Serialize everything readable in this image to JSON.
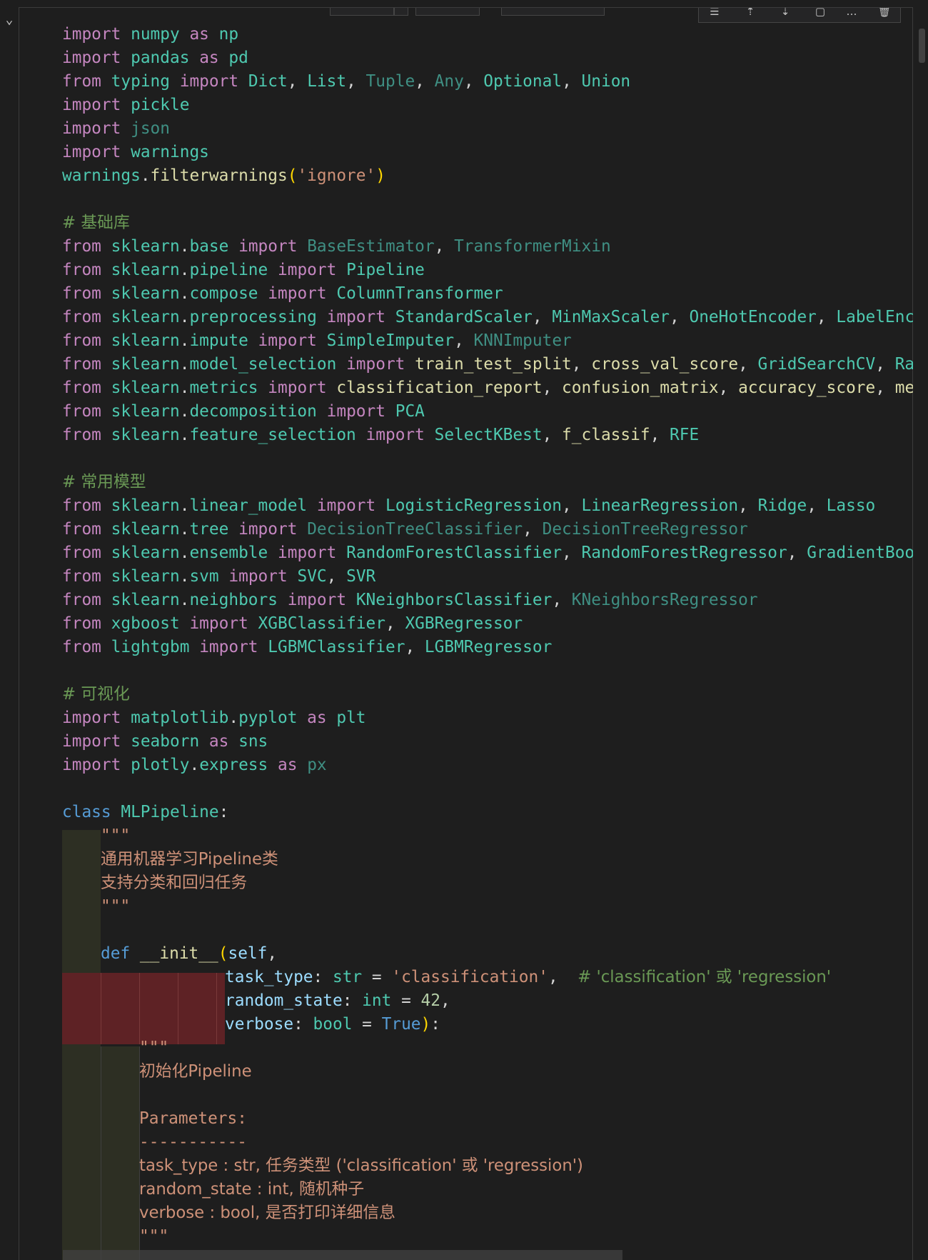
{
  "cell": {
    "collapse_icon": "chevron-down-icon",
    "toolbar_icons": [
      "format-lines-icon",
      "run-above-icon",
      "run-below-icon",
      "split-cell-icon",
      "more-icon",
      "delete-icon"
    ],
    "toolbar_glyphs": [
      "☰",
      "⇡",
      "⇣",
      "▢",
      "…",
      "🗑"
    ]
  },
  "code": {
    "l1": {
      "a": "import",
      "b": "numpy",
      "c": "as",
      "d": "np"
    },
    "l2": {
      "a": "import",
      "b": "pandas",
      "c": "as",
      "d": "pd"
    },
    "l3": {
      "a": "from",
      "b": "typing",
      "c": "import",
      "d": "Dict",
      "e": "List",
      "f": "Tuple",
      "g": "Any",
      "h": "Optional",
      "i": "Union"
    },
    "l4": {
      "a": "import",
      "b": "pickle"
    },
    "l5": {
      "a": "import",
      "b": "json"
    },
    "l6": {
      "a": "import",
      "b": "warnings"
    },
    "l7": {
      "a": "warnings",
      "b": "filterwarnings",
      "c": "'ignore'"
    },
    "c1": "# 基础库",
    "l9": {
      "a": "from",
      "b": "sklearn",
      "c": "base",
      "d": "import",
      "e": "BaseEstimator",
      "f": "TransformerMixin"
    },
    "l10": {
      "a": "from",
      "b": "sklearn",
      "c": "pipeline",
      "d": "import",
      "e": "Pipeline"
    },
    "l11": {
      "a": "from",
      "b": "sklearn",
      "c": "compose",
      "d": "import",
      "e": "ColumnTransformer"
    },
    "l12": {
      "a": "from",
      "b": "sklearn",
      "c": "preprocessing",
      "d": "import",
      "e": "StandardScaler",
      "f": "MinMaxScaler",
      "g": "OneHotEncoder",
      "h": "LabelEncod"
    },
    "l13": {
      "a": "from",
      "b": "sklearn",
      "c": "impute",
      "d": "import",
      "e": "SimpleImputer",
      "f": "KNNImputer"
    },
    "l14": {
      "a": "from",
      "b": "sklearn",
      "c": "model_selection",
      "d": "import",
      "e": "train_test_split",
      "f": "cross_val_score",
      "g": "GridSearchCV",
      "h": "Rand"
    },
    "l15": {
      "a": "from",
      "b": "sklearn",
      "c": "metrics",
      "d": "import",
      "e": "classification_report",
      "f": "confusion_matrix",
      "g": "accuracy_score",
      "h": "mean"
    },
    "l16": {
      "a": "from",
      "b": "sklearn",
      "c": "decomposition",
      "d": "import",
      "e": "PCA"
    },
    "l17": {
      "a": "from",
      "b": "sklearn",
      "c": "feature_selection",
      "d": "import",
      "e": "SelectKBest",
      "f": "f_classif",
      "g": "RFE"
    },
    "c2": "# 常用模型",
    "l19": {
      "a": "from",
      "b": "sklearn",
      "c": "linear_model",
      "d": "import",
      "e": "LogisticRegression",
      "f": "LinearRegression",
      "g": "Ridge",
      "h": "Lasso"
    },
    "l20": {
      "a": "from",
      "b": "sklearn",
      "c": "tree",
      "d": "import",
      "e": "DecisionTreeClassifier",
      "f": "DecisionTreeRegressor"
    },
    "l21": {
      "a": "from",
      "b": "sklearn",
      "c": "ensemble",
      "d": "import",
      "e": "RandomForestClassifier",
      "f": "RandomForestRegressor",
      "g": "GradientBoost"
    },
    "l22": {
      "a": "from",
      "b": "sklearn",
      "c": "svm",
      "d": "import",
      "e": "SVC",
      "f": "SVR"
    },
    "l23": {
      "a": "from",
      "b": "sklearn",
      "c": "neighbors",
      "d": "import",
      "e": "KNeighborsClassifier",
      "f": "KNeighborsRegressor"
    },
    "l24": {
      "a": "from",
      "b": "xgboost",
      "c": "import",
      "d": "XGBClassifier",
      "e": "XGBRegressor"
    },
    "l25": {
      "a": "from",
      "b": "lightgbm",
      "c": "import",
      "d": "LGBMClassifier",
      "e": "LGBMRegressor"
    },
    "c3": "# 可视化",
    "l27": {
      "a": "import",
      "b": "matplotlib",
      "c": "pyplot",
      "d": "as",
      "e": "plt"
    },
    "l28": {
      "a": "import",
      "b": "seaborn",
      "c": "as",
      "d": "sns"
    },
    "l29": {
      "a": "import",
      "b": "plotly",
      "c": "express",
      "d": "as",
      "e": "px"
    },
    "l31": {
      "a": "class",
      "b": "MLPipeline"
    },
    "d1": "\"\"\"",
    "d2": "通用机器学习Pipeline类",
    "d3": "支持分类和回归任务",
    "d4": "\"\"\"",
    "l36": {
      "a": "def",
      "b": "__init__",
      "c": "self"
    },
    "l37": {
      "a": "task_type",
      "b": "str",
      "c": "'classification'",
      "d": "# 'classification' 或 'regression'"
    },
    "l38": {
      "a": "random_state",
      "b": "int",
      "c": "42"
    },
    "l39": {
      "a": "verbose",
      "b": "bool",
      "c": "True"
    },
    "s1": "\"\"\"",
    "s2": "初始化Pipeline",
    "s3": "Parameters:",
    "s4": "-----------",
    "s5": "task_type : str, 任务类型 ('classification' 或 'regression')",
    "s6": "random_state : int, 随机种子",
    "s7": "verbose : bool, 是否打印详细信息",
    "s8": "\"\"\""
  }
}
